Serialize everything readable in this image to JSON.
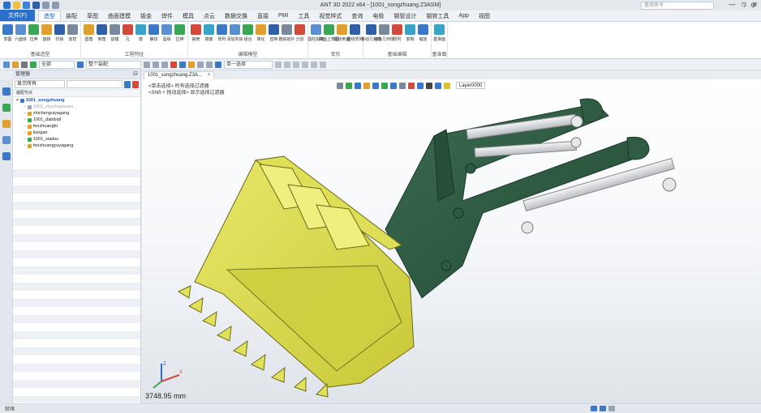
{
  "window": {
    "title": "ANT 3D 2022 x64 - [1001_songzhuang.Z3ASM]"
  },
  "ribbon_tabs": [
    "文件(F)",
    "造型",
    "装配",
    "草图",
    "曲面建模",
    "钣金",
    "焊件",
    "模具",
    "点云",
    "数据交换",
    "直接",
    "PMI",
    "工具",
    "视觉样式",
    "查询",
    "电极",
    "钢管设计",
    "钢铁工具",
    "App",
    "视图"
  ],
  "active_tab_index": 1,
  "search_placeholder": "查找命令",
  "ribbon_groups": [
    {
      "label": "基础造型",
      "buttons": [
        "草图",
        "六面体",
        "拉伸",
        "旋转",
        "扫掠",
        "放样"
      ]
    },
    {
      "label": "工程特征",
      "buttons": [
        "圆角",
        "倒角",
        "拔模",
        "孔",
        "筋",
        "螺纹",
        "唇缘",
        "拉伸"
      ]
    },
    {
      "label": "编辑模型",
      "buttons": [
        "抽壳",
        "镜像",
        "阵列",
        "添加实体",
        "组合",
        "简化",
        "替换",
        "删除拓扑",
        "分割"
      ]
    },
    {
      "label": "变形",
      "buttons": [
        "圆柱折弯",
        "曲面上草图",
        "缠绕到面",
        "缠绕阵列"
      ]
    },
    {
      "label": "基础编辑",
      "buttons": [
        "移动几何体",
        "镜像几何体",
        "阵列",
        "复制",
        "缩放"
      ]
    },
    {
      "label": "基准面",
      "buttons": [
        "基准面"
      ]
    }
  ],
  "toolbar": {
    "filter_label": "全部",
    "selection_label": "整个装配",
    "pick_label": "单一选择"
  },
  "panel": {
    "title": "管理器",
    "filter_mode": "显示所有",
    "tree_header": "装配节点",
    "tree": [
      {
        "label": "1001_songzhuang",
        "depth": 0,
        "state": "selected"
      },
      {
        "label": "1001_zhuchuanxiao",
        "depth": 1,
        "state": "ghost"
      },
      {
        "label": "zhichenguiyagang",
        "depth": 1,
        "state": "normal"
      },
      {
        "label": "1001_dabibidi",
        "depth": 1,
        "state": "normal"
      },
      {
        "label": "fenzhuangbi",
        "depth": 1,
        "state": "normal"
      },
      {
        "label": "liangan",
        "depth": 1,
        "state": "normal"
      },
      {
        "label": "1001_xiadou",
        "depth": 1,
        "state": "normal"
      },
      {
        "label": "fenzhuangyuyagang",
        "depth": 1,
        "state": "normal"
      }
    ]
  },
  "document_tab": {
    "label": "1001_songzhuang.Z3A...",
    "close": "×"
  },
  "viewport": {
    "hints": [
      "<单击选择> 所有选择过滤器",
      "<Shift + 拖动选择> 显示选择过滤器"
    ],
    "layer": "Layer0000",
    "measurement": "3748.95 mm",
    "colors": {
      "bucket": "#d9d94a",
      "boom": "#2f5c42",
      "cylinder": "#d8dbde"
    }
  },
  "status": {
    "text": "就绪"
  }
}
